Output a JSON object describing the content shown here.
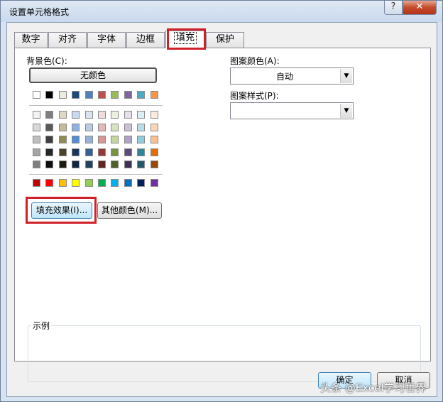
{
  "window": {
    "title": "设置单元格格式",
    "help_label": "?",
    "close_label": "✕"
  },
  "tabs": [
    {
      "label": "数字"
    },
    {
      "label": "对齐"
    },
    {
      "label": "字体"
    },
    {
      "label": "边框"
    },
    {
      "label": "填充"
    },
    {
      "label": "保护"
    }
  ],
  "fill": {
    "background_color_label": "背景色(C):",
    "no_color_label": "无颜色",
    "fill_effects_label": "填充效果(I)...",
    "more_colors_label": "其他颜色(M)...",
    "pattern_color_label": "图案颜色(A):",
    "pattern_color_value": "自动",
    "pattern_style_label": "图案样式(P):",
    "pattern_style_value": "",
    "sample_label": "示例"
  },
  "palette": {
    "theme_top": [
      "#ffffff",
      "#000000",
      "#eeece1",
      "#1f497d",
      "#4f81bd",
      "#c0504d",
      "#9bbb59",
      "#8064a2",
      "#4bacc6",
      "#f79646"
    ],
    "theme_shades": [
      [
        "#f2f2f2",
        "#7f7f7f",
        "#ddd9c3",
        "#c6d9f0",
        "#dbe5f1",
        "#f2dcdb",
        "#ebf1dd",
        "#e5e0ec",
        "#dbeef3",
        "#fdeada"
      ],
      [
        "#d8d8d8",
        "#595959",
        "#c4bd97",
        "#8db3e2",
        "#b8cce4",
        "#e5b9b7",
        "#d7e3bc",
        "#ccc1d9",
        "#b7dde8",
        "#fbd5b5"
      ],
      [
        "#bfbfbf",
        "#3f3f3f",
        "#938953",
        "#548dd4",
        "#95b3d7",
        "#d99694",
        "#c3d69b",
        "#b2a2c7",
        "#92cddc",
        "#fac08f"
      ],
      [
        "#a5a5a5",
        "#262626",
        "#494429",
        "#17365d",
        "#366092",
        "#953734",
        "#76923c",
        "#5f497a",
        "#31859b",
        "#e36c09"
      ],
      [
        "#7f7f7f",
        "#0c0c0c",
        "#1d1b10",
        "#0f243e",
        "#244061",
        "#632423",
        "#4f6128",
        "#3f3151",
        "#205867",
        "#974806"
      ]
    ],
    "standard": [
      "#c00000",
      "#ff0000",
      "#ffc000",
      "#ffff00",
      "#92d050",
      "#00b050",
      "#00b0f0",
      "#0070c0",
      "#002060",
      "#7030a0"
    ]
  },
  "footer": {
    "ok_label": "确定",
    "cancel_label": "取消"
  },
  "watermark": "头条 @Excel学习世界"
}
